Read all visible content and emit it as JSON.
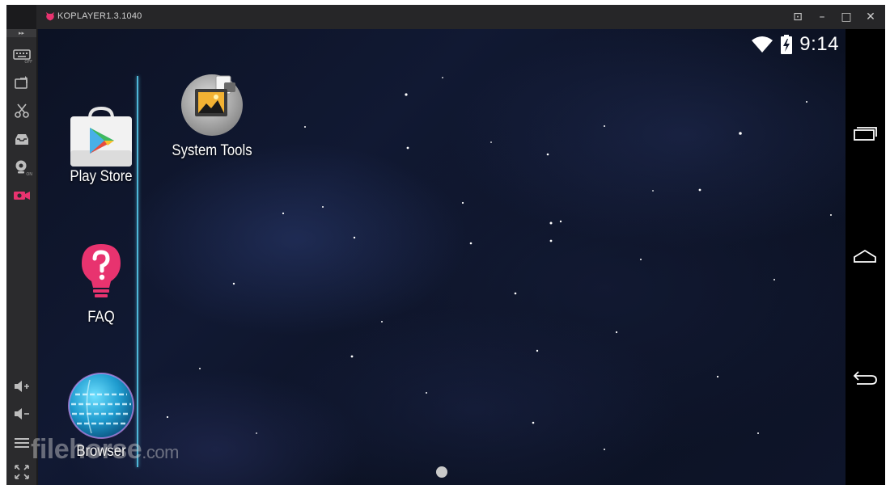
{
  "window": {
    "title": "KOPLAYER1.3.1040",
    "controls": [
      {
        "name": "mini-mode-icon",
        "glyph": "⊡"
      },
      {
        "name": "minimize-icon",
        "glyph": "–"
      },
      {
        "name": "maximize-icon",
        "glyph": "□"
      },
      {
        "name": "close-icon",
        "glyph": "✕"
      }
    ]
  },
  "toolbar": {
    "collapse_glyph": "▸▸",
    "keyboard_sub": "OFF",
    "camera_sub": "ON",
    "tools": [
      "keyboard-icon",
      "screen-rotate-icon",
      "screenshot-scissors-icon",
      "inbox-icon",
      "webcam-icon",
      "video-record-icon",
      "volume-up-icon",
      "volume-down-icon",
      "menu-icon",
      "fullscreen-icon"
    ]
  },
  "statusbar": {
    "time": "9:14",
    "icons": [
      "wifi-icon",
      "battery-charging-icon"
    ]
  },
  "dock": {
    "apps": [
      {
        "label": "Play Store",
        "icon": "play-store-icon"
      },
      {
        "label": "FAQ",
        "icon": "faq-icon"
      },
      {
        "label": "Browser",
        "icon": "browser-globe-icon"
      }
    ]
  },
  "desktop": {
    "apps": [
      {
        "label": "System Tools",
        "icon": "system-tools-folder-icon"
      }
    ]
  },
  "navbar": {
    "buttons": [
      "recent-apps-icon",
      "home-icon",
      "back-icon"
    ]
  },
  "watermark": {
    "text": "filehorse",
    "suffix": ".com"
  },
  "colors": {
    "accent": "#e8336f",
    "divider": "#4fb7d8",
    "titlebar": "#262628"
  }
}
